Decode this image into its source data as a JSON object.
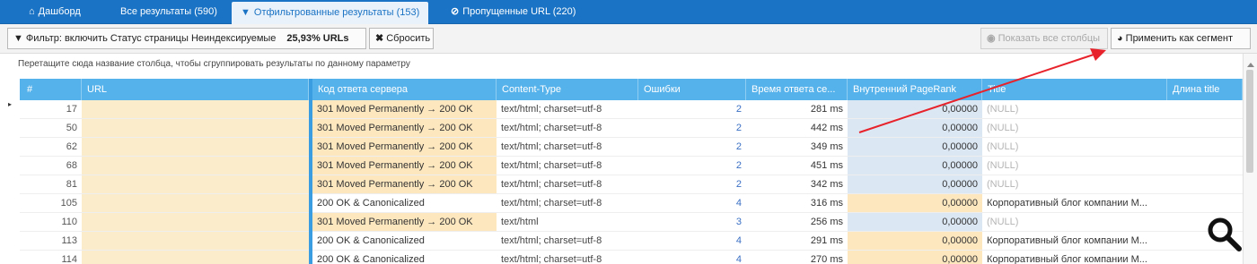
{
  "tabs": [
    {
      "icon": "home-icon",
      "glyph": "⌂",
      "label": "Дашборд",
      "active": false
    },
    {
      "label": "Все результаты (590)",
      "active": false
    },
    {
      "icon": "filter-icon",
      "glyph": "▼",
      "label": "Отфильтрованные результаты (153)",
      "active": true
    },
    {
      "icon": "block-icon",
      "glyph": "⊘",
      "label": "Пропущенные URL (220)",
      "active": false
    }
  ],
  "toolbar": {
    "filter_label": "Фильтр: включить Статус страницы Неиндексируемые",
    "filter_percent": "25,93% URLs",
    "reset_label": "Сбросить",
    "show_columns_label": "Показать все столбцы",
    "apply_segment_label": "Применить как сегмент"
  },
  "group_hint": "Перетащите сюда название столбца, чтобы сгруппировать результаты по данному параметру",
  "columns": [
    "#",
    "URL",
    "Код ответа сервера",
    "Content-Type",
    "Ошибки",
    "Время ответа се...",
    "Внутренний PageRank",
    "Title",
    "Длина title"
  ],
  "rows": [
    {
      "num": "17",
      "status": "301 Moved Permanently → 200 OK",
      "ct": "text/html; charset=utf-8",
      "errors": "2",
      "time": "281 ms",
      "pr": "0,00000",
      "title": "(NULL)"
    },
    {
      "num": "50",
      "status": "301 Moved Permanently → 200 OK",
      "ct": "text/html; charset=utf-8",
      "errors": "2",
      "time": "442 ms",
      "pr": "0,00000",
      "title": "(NULL)"
    },
    {
      "num": "62",
      "status": "301 Moved Permanently → 200 OK",
      "ct": "text/html; charset=utf-8",
      "errors": "2",
      "time": "349 ms",
      "pr": "0,00000",
      "title": "(NULL)"
    },
    {
      "num": "68",
      "status": "301 Moved Permanently → 200 OK",
      "ct": "text/html; charset=utf-8",
      "errors": "2",
      "time": "451 ms",
      "pr": "0,00000",
      "title": "(NULL)"
    },
    {
      "num": "81",
      "status": "301 Moved Permanently → 200 OK",
      "ct": "text/html; charset=utf-8",
      "errors": "2",
      "time": "342 ms",
      "pr": "0,00000",
      "title": "(NULL)"
    },
    {
      "num": "105",
      "status": "200 OK & Canonicalized",
      "ct": "text/html; charset=utf-8",
      "errors": "4",
      "time": "316 ms",
      "pr": "0,00000",
      "title": "Корпоративный блог компании М..."
    },
    {
      "num": "110",
      "status": "301 Moved Permanently → 200 OK",
      "ct": "text/html",
      "errors": "3",
      "time": "256 ms",
      "pr": "0,00000",
      "title": "(NULL)"
    },
    {
      "num": "113",
      "status": "200 OK & Canonicalized",
      "ct": "text/html; charset=utf-8",
      "errors": "4",
      "time": "291 ms",
      "pr": "0,00000",
      "title": "Корпоративный блог компании М..."
    },
    {
      "num": "114",
      "status": "200 OK & Canonicalized",
      "ct": "text/html; charset=utf-8",
      "errors": "4",
      "time": "270 ms",
      "pr": "0,00000",
      "title": "Корпоративный блог компании М..."
    }
  ],
  "colors": {
    "tab_bar": "#1a73c4",
    "header": "#56b2ea",
    "redirect_highlight": "#fde7bf",
    "pagerank_highlight": "#dbe7f3",
    "annotation_arrow": "#e8222a"
  }
}
